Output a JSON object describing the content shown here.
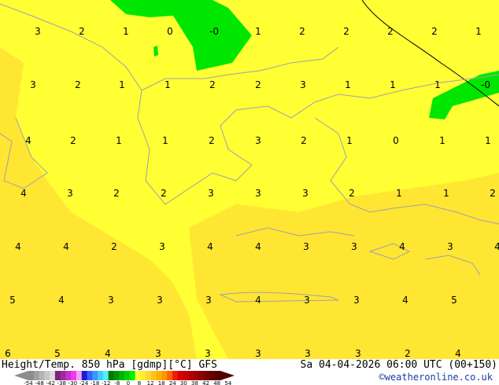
{
  "map": {
    "colors": {
      "yellow": "#ffff33",
      "dark_yellow": "#ffe632",
      "green": "#00e600",
      "coast": "#a0a0b4",
      "isoline": "#000000"
    },
    "values": [
      [
        "3",
        "2",
        "1",
        "0",
        "-0",
        "1",
        "2",
        "2",
        "2",
        "2",
        "1"
      ],
      [
        "3",
        "2",
        "1",
        "1",
        "2",
        "2",
        "3",
        "1",
        "1",
        "1",
        "-0"
      ],
      [
        "4",
        "2",
        "1",
        "1",
        "2",
        "3",
        "2",
        "1",
        "0",
        "1",
        "1"
      ],
      [
        "4",
        "3",
        "2",
        "2",
        "3",
        "3",
        "3",
        "2",
        "1",
        "1",
        "2"
      ],
      [
        "4",
        "4",
        "2",
        "3",
        "4",
        "4",
        "3",
        "3",
        "4",
        "3",
        "4"
      ],
      [
        "5",
        "4",
        "3",
        "3",
        "3",
        "4",
        "3",
        "3",
        "4",
        "5"
      ],
      [
        "6",
        "5",
        "4",
        "3",
        "3",
        "3",
        "3",
        "3",
        "2",
        "4"
      ]
    ]
  },
  "footer": {
    "title": "Height/Temp. 850 hPa [gdmp][°C] GFS",
    "datetime": "Sa 04-04-2026 06:00 UTC (00+150)",
    "credit": "©weatheronline.co.uk",
    "scale_ticks": [
      "-54",
      "-48",
      "-42",
      "-38",
      "-30",
      "-24",
      "-18",
      "-12",
      "-8",
      "0",
      "8",
      "12",
      "18",
      "24",
      "30",
      "38",
      "42",
      "48",
      "54"
    ],
    "scale_colors": [
      "#8c8c8c",
      "#a0a0a0",
      "#b4b4b4",
      "#c8c8c8",
      "#dcdcdc",
      "#782878",
      "#a028a0",
      "#c832c8",
      "#f03cf0",
      "#f8a0f8",
      "#1e1ec8",
      "#3264ff",
      "#3c96ff",
      "#46c8ff",
      "#50f0ff",
      "#007800",
      "#009600",
      "#00b400",
      "#00d200",
      "#00f000",
      "#ffff32",
      "#ffeb32",
      "#ffd732",
      "#ffc31e",
      "#ffaf00",
      "#ff9600",
      "#ff6400",
      "#f01e00",
      "#dc0000",
      "#c80000",
      "#b40000",
      "#a00000",
      "#8c0000",
      "#780000",
      "#640000",
      "#500000"
    ]
  }
}
